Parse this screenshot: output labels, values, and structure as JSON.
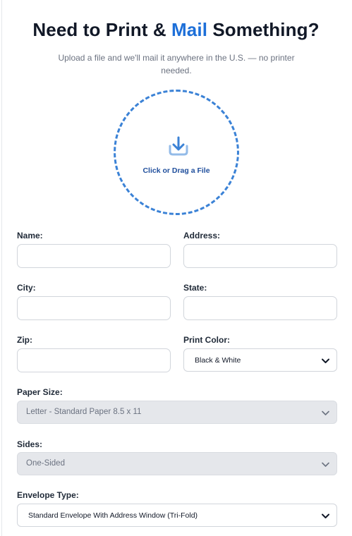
{
  "header": {
    "title_part1": "Need to Print & ",
    "title_accent": "Mail",
    "title_part2": " Something?",
    "subtitle": "Upload a file and we'll mail it anywhere in the U.S. — no printer needed."
  },
  "upload": {
    "icon": "upload-tray-icon",
    "label": "Click or Drag a File"
  },
  "form": {
    "name": {
      "label": "Name:",
      "value": ""
    },
    "address": {
      "label": "Address:",
      "value": ""
    },
    "city": {
      "label": "City:",
      "value": ""
    },
    "state": {
      "label": "State:",
      "value": ""
    },
    "zip": {
      "label": "Zip:",
      "value": ""
    },
    "print_color": {
      "label": "Print Color:",
      "selected": "Black & White",
      "disabled": false
    },
    "paper_size": {
      "label": "Paper Size:",
      "selected": "Letter - Standard Paper 8.5 x 11",
      "disabled": true
    },
    "sides": {
      "label": "Sides:",
      "selected": "One-Sided",
      "disabled": true
    },
    "envelope_type": {
      "label": "Envelope Type:",
      "selected": "Standard Envelope With Address Window (Tri-Fold)",
      "disabled": false
    }
  },
  "colors": {
    "accent": "#1d6fd8",
    "drop_border": "#3b82d6",
    "disabled_bg": "#e5e7eb"
  }
}
